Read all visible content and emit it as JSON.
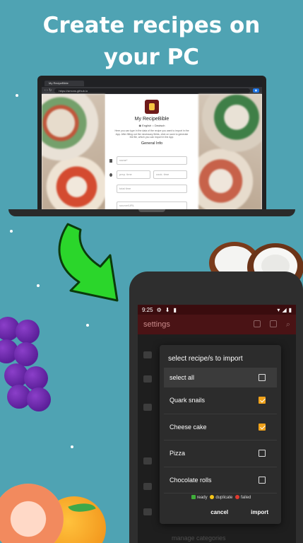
{
  "headline": {
    "line1": "Create recipes on",
    "line2": "your PC"
  },
  "laptop": {
    "tab_title": "My RecipeBible",
    "url": "https://simons.github.io",
    "site_title": "My RecipeBible",
    "lang_english": "English",
    "lang_deutsch": "Deutsch",
    "description": "Here you can type in the data of the recipe you want to import in the App. After filling out the necessary fields, click on save to generate the file, which you can import in the App.",
    "section": "General Info",
    "fields": {
      "name": "name*",
      "prep": "prep. time",
      "cook": "cook. time",
      "total": "total time",
      "source": "source/URL"
    }
  },
  "phone": {
    "status": {
      "time": "9:25"
    },
    "appbar_title": "settings",
    "background_footer": "manage categories",
    "dialog": {
      "title": "select recipe/s to import",
      "rows": [
        {
          "label": "select all",
          "checked": false
        },
        {
          "label": "Quark snails",
          "checked": true
        },
        {
          "label": "Cheese cake",
          "checked": true
        },
        {
          "label": "Pizza",
          "checked": false
        },
        {
          "label": "Chocolate rolls",
          "checked": false
        }
      ],
      "legend": {
        "ready": "ready",
        "duplicate": "duplicate",
        "failed": "failed"
      },
      "cancel": "cancel",
      "import": "import"
    }
  },
  "colors": {
    "background": "#4fa3b3",
    "accent_checkbox": "#f0a21a",
    "appbar": "#4a1315",
    "legend_ready": "#3fae3a",
    "legend_duplicate": "#f5c518",
    "legend_failed": "#e03a2f",
    "arrow": "#2bd62b"
  }
}
